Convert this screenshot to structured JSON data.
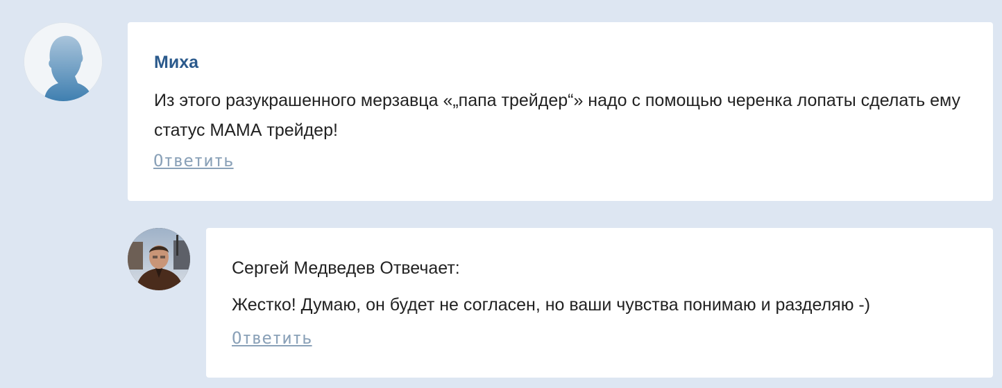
{
  "comments": [
    {
      "author": "Миха",
      "avatar_icon": "default-user-silhouette-icon",
      "text": "Из этого разукрашенного мерзавца «„папа трейдер“» надо с помощью черенка лопаты сделать ему статус МАМА трейдер!",
      "reply_label": "Ответить"
    },
    {
      "header": "Сергей Медведев Отвечает:",
      "avatar_icon": "user-photo-icon",
      "text": "Жестко! Думаю, он будет не согласен, но ваши чувства понимаю и разделяю -)",
      "reply_label": "Ответить"
    }
  ],
  "colors": {
    "background": "#dde6f2",
    "card": "#ffffff",
    "author_name": "#2b5a8c",
    "reply_link": "#8aa1b8",
    "text": "#222222"
  }
}
